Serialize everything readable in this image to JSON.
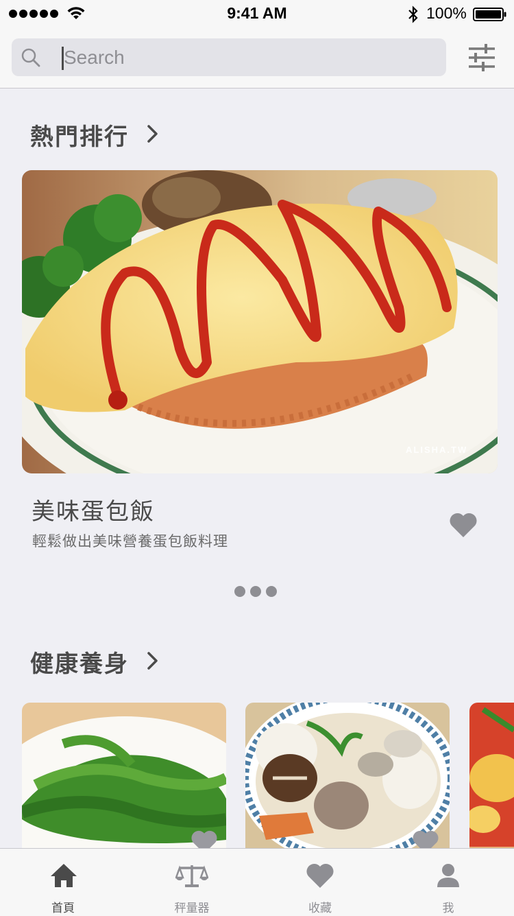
{
  "status_bar": {
    "time": "9:41 AM",
    "battery": "100%",
    "icons": [
      "signal-dots-icon",
      "wifi-icon",
      "bluetooth-icon",
      "battery-icon"
    ]
  },
  "search": {
    "placeholder": "Search",
    "value": "",
    "icons": [
      "search-icon",
      "filter-sliders-icon"
    ]
  },
  "popular": {
    "heading": "熱門排行",
    "featured": {
      "title": "美味蛋包飯",
      "subtitle": "輕鬆做出美味營養蛋包飯料理",
      "watermark": "ALISHA.TW",
      "favorite_icon": "heart-icon"
    },
    "pager_dots": 3
  },
  "health": {
    "heading": "健康養身",
    "cards": [
      {
        "image": "stir-fried-greens",
        "favorite_icon": "heart-icon"
      },
      {
        "image": "clam-radish-soup",
        "favorite_icon": "heart-icon"
      },
      {
        "image": "tomato-egg",
        "favorite_icon": "heart-icon"
      }
    ]
  },
  "tab_bar": {
    "items": [
      {
        "label": "首頁",
        "icon": "home-icon",
        "active": true
      },
      {
        "label": "秤量器",
        "icon": "scale-icon",
        "active": false
      },
      {
        "label": "收藏",
        "icon": "heart-icon",
        "active": false
      },
      {
        "label": "我",
        "icon": "person-icon",
        "active": false
      }
    ]
  },
  "colors": {
    "background": "#efeff4",
    "bar": "#f7f7f7",
    "icon_gray": "#8e8e93",
    "text": "#4a4a4a"
  }
}
